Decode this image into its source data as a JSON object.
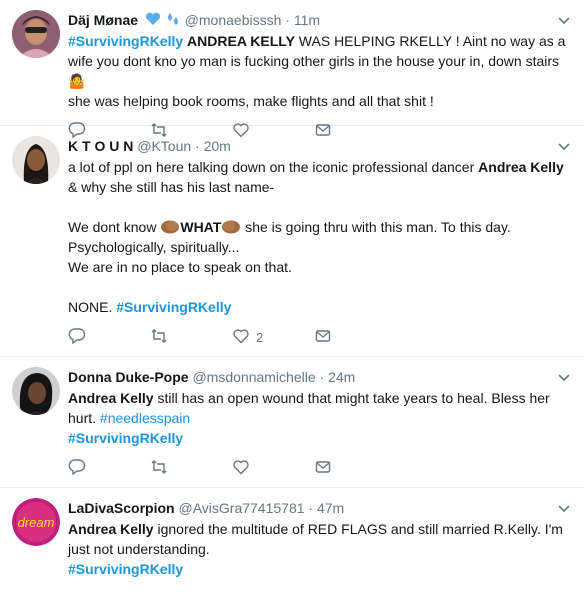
{
  "tweets": [
    {
      "name": "Däj Mønae",
      "handle": "@monaebisssh",
      "time": "11m",
      "text": {
        "tag": "#SurvivingRKelly",
        "bold": "ANDREA KELLY",
        "rest": " WAS HELPING RKELLY ! Aint no way as a wife you dont kno yo man is fucking other girls in the house your in, down stairs 🤷",
        "line2": "she was helping book rooms, make flights and all that shit !"
      },
      "likes": ""
    },
    {
      "name": "K T O U N",
      "handle": "@KToun",
      "time": "20m",
      "text": {
        "p1a": "a lot of ppl on here talking down on the iconic professional dancer ",
        "p1b": "Andrea Kelly",
        "p1c": "& why she still has his last name-",
        "p2a": "We dont know ",
        "p2b": "WHAT",
        "p2c": " she is going thru with this man. To this day.",
        "p3": "Psychologically, spiritually...",
        "p4": "We are in no place to speak on that.",
        "p5a": "NONE. ",
        "p5b": "#SurvivingRKelly"
      },
      "likes": "2"
    },
    {
      "name": "Donna Duke-Pope",
      "handle": "@msdonnamichelle",
      "time": "24m",
      "text": {
        "bold": "Andrea Kelly",
        "rest": " still has an open wound that might take years to heal. Bless her hurt. ",
        "tag1": "#needlesspain",
        "tag2": "#SurvivingRKelly"
      },
      "likes": ""
    },
    {
      "name": "LaDivaScorpion",
      "handle": "@AvisGra77415781",
      "time": "47m",
      "avatar_text": "dream",
      "text": {
        "bold": "Andrea Kelly",
        "rest": " ignored the multitude of RED FLAGS and still married R.Kelly. I'm just not understanding.",
        "tag": "#SurvivingRKelly"
      },
      "likes": ""
    }
  ],
  "dot": "·",
  "colors": {
    "link": "#1b95e0",
    "secondary": "#657786",
    "border": "#e6ecf0"
  },
  "icons": [
    "reply-icon",
    "retweet-icon",
    "like-icon",
    "message-icon",
    "chevron-down-icon",
    "blue-heart-icon",
    "sweat-droplets-icon",
    "clap-icon"
  ]
}
